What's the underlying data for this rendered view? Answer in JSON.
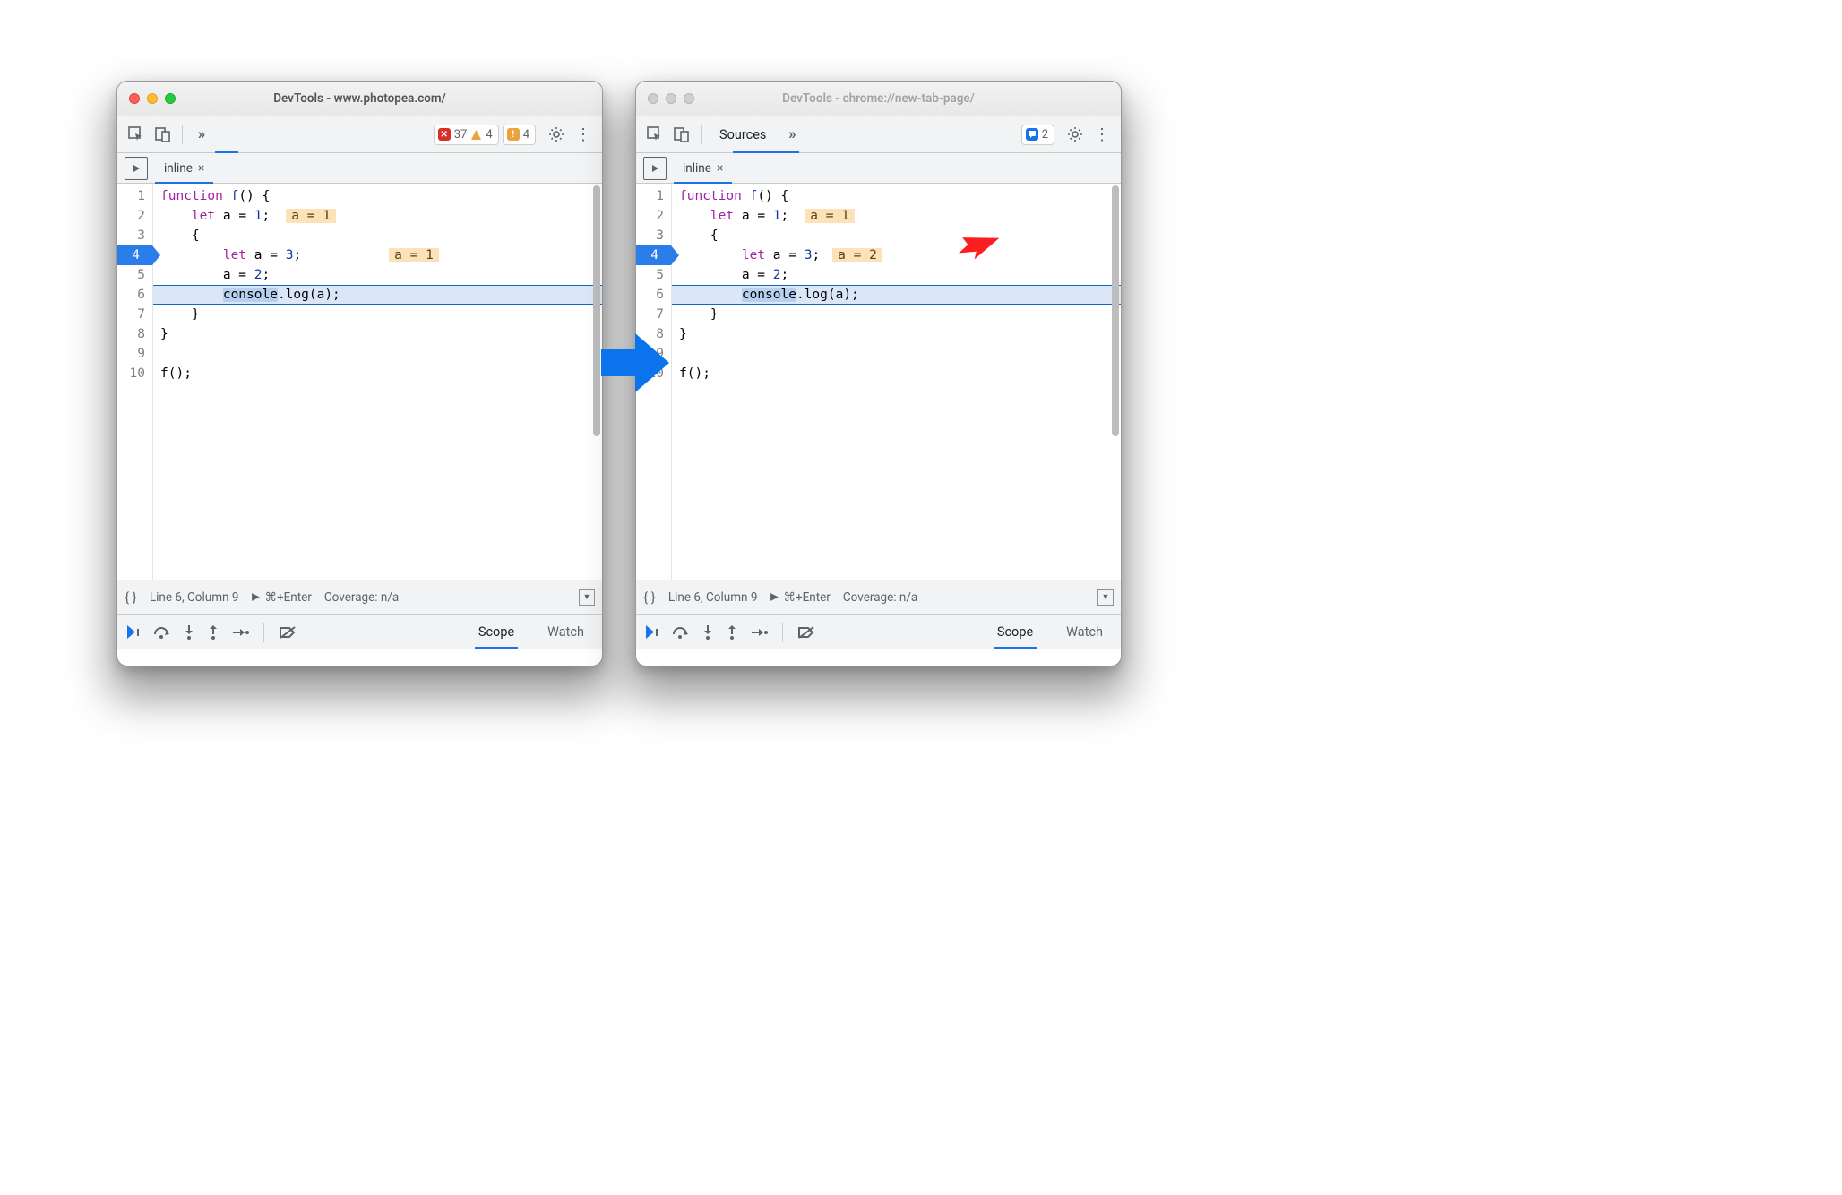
{
  "left": {
    "title": "DevTools - www.photopea.com/",
    "active": true,
    "toolbar": {
      "errors": "37",
      "warnings_triangle": "4",
      "warnings_square": "4"
    },
    "tab": {
      "name": "inline"
    },
    "code": {
      "lines": [
        {
          "n": "1",
          "t": [
            "function",
            " ",
            "f",
            "() {"
          ],
          "c": [
            "k-purple",
            "k-black",
            "k-blue",
            "k-black"
          ]
        },
        {
          "n": "2",
          "pad": "    ",
          "t": [
            "let",
            " a = ",
            "1",
            ";"
          ],
          "c": [
            "k-purple",
            "k-black",
            "k-blue",
            "k-black"
          ],
          "inline": "a = 1"
        },
        {
          "n": "3",
          "pad": "    ",
          "t": [
            "{"
          ],
          "c": [
            "k-black"
          ]
        },
        {
          "n": "4",
          "pad": "        ",
          "t": [
            "let",
            " a = ",
            "3",
            ";"
          ],
          "c": [
            "k-purple",
            "k-black",
            "k-blue",
            "k-black"
          ],
          "inline": "a = 1",
          "exec": true,
          "inl_gap": "98px"
        },
        {
          "n": "5",
          "pad": "        ",
          "t": [
            "a = ",
            "2",
            ";"
          ],
          "c": [
            "k-black",
            "k-blue",
            "k-black"
          ]
        },
        {
          "n": "6",
          "pad": "        ",
          "t": [
            "console",
            ".log(a);"
          ],
          "c": [
            "k-black",
            "k-black"
          ],
          "sel": 0,
          "hl": true
        },
        {
          "n": "7",
          "pad": "    ",
          "t": [
            "}"
          ],
          "c": [
            "k-black"
          ]
        },
        {
          "n": "8",
          "t": [
            "}"
          ],
          "c": [
            "k-black"
          ]
        },
        {
          "n": "9",
          "t": [
            ""
          ],
          "c": [
            "k-black"
          ]
        },
        {
          "n": "10",
          "t": [
            "f();"
          ],
          "c": [
            "k-black"
          ]
        }
      ]
    },
    "status": {
      "pos": "Line 6, Column 9",
      "run": "⌘+Enter",
      "cov": "Coverage: n/a"
    },
    "panels": {
      "scope": "Scope",
      "watch": "Watch"
    }
  },
  "right": {
    "title": "DevTools - chrome://new-tab-page/",
    "active": false,
    "toolbar": {
      "sources_label": "Sources",
      "msg_count": "2"
    },
    "tab": {
      "name": "inline"
    },
    "code": {
      "lines": [
        {
          "n": "1",
          "t": [
            "function",
            " ",
            "f",
            "() {"
          ],
          "c": [
            "k-purple",
            "k-black",
            "k-blue",
            "k-black"
          ]
        },
        {
          "n": "2",
          "pad": "    ",
          "t": [
            "let",
            " a = ",
            "1",
            ";"
          ],
          "c": [
            "k-purple",
            "k-black",
            "k-blue",
            "k-black"
          ],
          "inline": "a = 1"
        },
        {
          "n": "3",
          "pad": "    ",
          "t": [
            "{"
          ],
          "c": [
            "k-black"
          ]
        },
        {
          "n": "4",
          "pad": "        ",
          "t": [
            "let",
            " a = ",
            "3",
            ";"
          ],
          "c": [
            "k-purple",
            "k-black",
            "k-blue",
            "k-black"
          ],
          "inline": "a = 2",
          "exec": true,
          "inl_gap": "14px"
        },
        {
          "n": "5",
          "pad": "        ",
          "t": [
            "a = ",
            "2",
            ";"
          ],
          "c": [
            "k-black",
            "k-blue",
            "k-black"
          ]
        },
        {
          "n": "6",
          "pad": "        ",
          "t": [
            "console",
            ".log(a);"
          ],
          "c": [
            "k-black",
            "k-black"
          ],
          "sel": 0,
          "hl": true
        },
        {
          "n": "7",
          "pad": "    ",
          "t": [
            "}"
          ],
          "c": [
            "k-black"
          ]
        },
        {
          "n": "8",
          "t": [
            "}"
          ],
          "c": [
            "k-black"
          ]
        },
        {
          "n": "9",
          "t": [
            ""
          ],
          "c": [
            "k-black"
          ]
        },
        {
          "n": "10",
          "t": [
            "f();"
          ],
          "c": [
            "k-black"
          ]
        }
      ]
    },
    "status": {
      "pos": "Line 6, Column 9",
      "run": "⌘+Enter",
      "cov": "Coverage: n/a"
    },
    "panels": {
      "scope": "Scope",
      "watch": "Watch"
    }
  }
}
